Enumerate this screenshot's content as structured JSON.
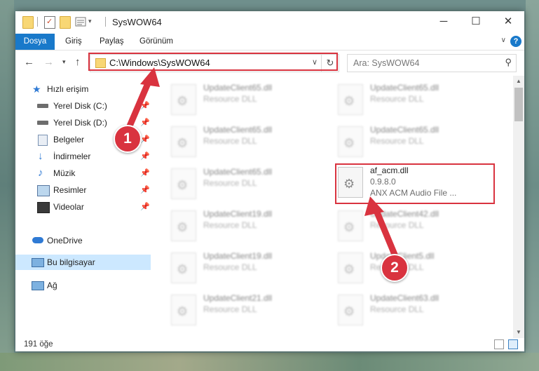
{
  "window": {
    "title": "SysWOW64",
    "quick_access_toolbar": [
      "folder-icon",
      "properties-icon",
      "new-folder-icon",
      "view-options-icon"
    ],
    "controls": [
      "minimize-icon",
      "maximize-icon",
      "close-icon"
    ]
  },
  "ribbon": {
    "tabs": [
      {
        "label": "Dosya",
        "active": true
      },
      {
        "label": "Giriş"
      },
      {
        "label": "Paylaş"
      },
      {
        "label": "Görünüm"
      }
    ],
    "help": "?"
  },
  "nav": {
    "address": "C:\\Windows\\SysWOW64",
    "search_placeholder": "Ara: SysWOW64",
    "refresh_icon": "↻"
  },
  "sidebar": {
    "items": [
      {
        "label": "Hızlı erişim",
        "icon": "star-icon"
      },
      {
        "label": "Yerel Disk (C:)",
        "icon": "drive-icon",
        "pinned": true
      },
      {
        "label": "Yerel Disk (D:)",
        "icon": "drive-icon",
        "pinned": true
      },
      {
        "label": "Belgeler",
        "icon": "documents-icon",
        "pinned": true
      },
      {
        "label": "İndirmeler",
        "icon": "downloads-icon",
        "pinned": true
      },
      {
        "label": "Müzik",
        "icon": "music-icon",
        "pinned": true
      },
      {
        "label": "Resimler",
        "icon": "pictures-icon",
        "pinned": true
      },
      {
        "label": "Videolar",
        "icon": "videos-icon",
        "pinned": true
      },
      {
        "label": "OneDrive",
        "icon": "cloud-icon"
      },
      {
        "label": "Bu bilgisayar",
        "icon": "computer-icon",
        "selected": true
      },
      {
        "label": "Ağ",
        "icon": "network-icon"
      }
    ]
  },
  "files": [
    {
      "name": "UpdateClient65.dll",
      "type": "Resource DLL"
    },
    {
      "name": "UpdateClient65.dll",
      "type": "Resource DLL"
    },
    {
      "name": "UpdateClient65.dll",
      "type": "Resource DLL"
    },
    {
      "name": "UpdateClient65.dll",
      "type": "Resource DLL"
    },
    {
      "name": "UpdateClient65.dll",
      "type": "Resource DLL"
    },
    {
      "name": "af_acm.dll",
      "version": "0.9.8.0",
      "type": "ANX ACM Audio File ...",
      "highlighted": true
    },
    {
      "name": "UpdateClient19.dll",
      "type": "Resource DLL"
    },
    {
      "name": "UpdateClient42.dll",
      "type": "Resource DLL"
    },
    {
      "name": "UpdateClient19.dll",
      "type": "Resource DLL"
    },
    {
      "name": "UpdateClient5.dll",
      "type": "Resource DLL"
    },
    {
      "name": "UpdateClient21.dll",
      "type": "Resource DLL"
    },
    {
      "name": "UpdateClient63.dll",
      "type": "Resource DLL"
    }
  ],
  "status": {
    "item_count": "191 öğe"
  },
  "annotations": {
    "badge1": "1",
    "badge2": "2",
    "color": "#d9333f"
  }
}
